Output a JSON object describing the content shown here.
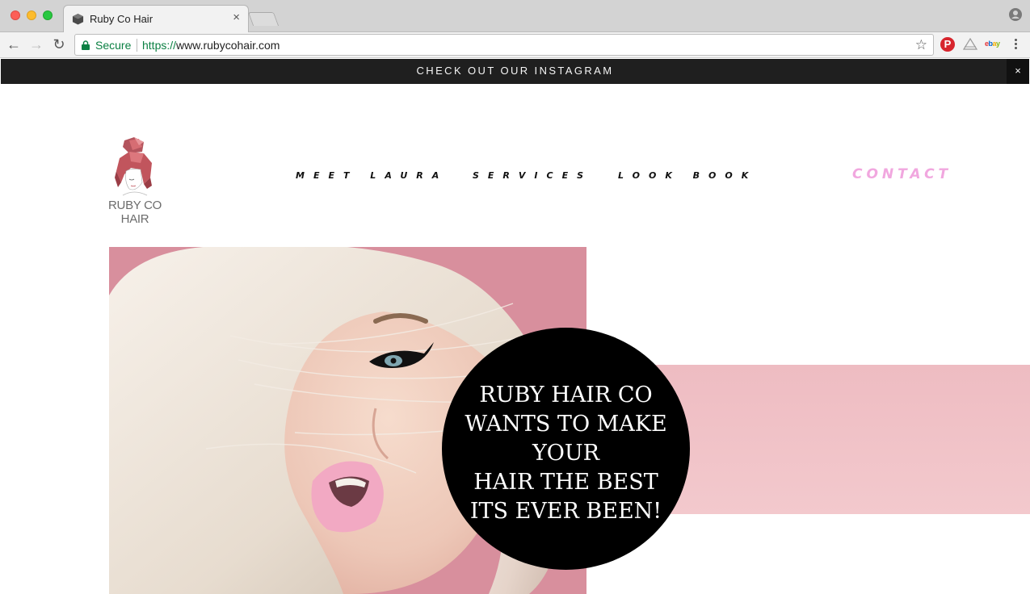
{
  "browser": {
    "tab_title": "Ruby Co Hair",
    "tab_close": "×",
    "secure_label": "Secure",
    "url_scheme": "https://",
    "url_host": "www.rubycohair.com",
    "icons": [
      "back-icon",
      "forward-icon",
      "reload-icon",
      "lock-icon",
      "star-icon",
      "pinterest-icon",
      "extension-icon",
      "ebay-icon",
      "menu-icon",
      "profile-icon"
    ]
  },
  "banner": {
    "text": "CHECK OUT OUR INSTAGRAM",
    "close_label": "×"
  },
  "logo": {
    "text": "RUBY CO HAIR"
  },
  "nav": {
    "items": [
      {
        "label": "MEET LAURA"
      },
      {
        "label": "SERVICES"
      },
      {
        "label": "LOOK BOOK"
      },
      {
        "label": "CONTACT"
      }
    ]
  },
  "hero": {
    "lines": [
      "RUBY HAIR CO",
      "WANTS TO MAKE",
      "YOUR",
      "HAIR THE BEST",
      "ITS EVER BEEN!"
    ]
  },
  "colors": {
    "accent_contact": "#f1a7df",
    "hero_pink": "#d88f9d",
    "band_pink": "#eebcc2",
    "circle": "#000000",
    "banner_bg": "#1f1f1f"
  }
}
